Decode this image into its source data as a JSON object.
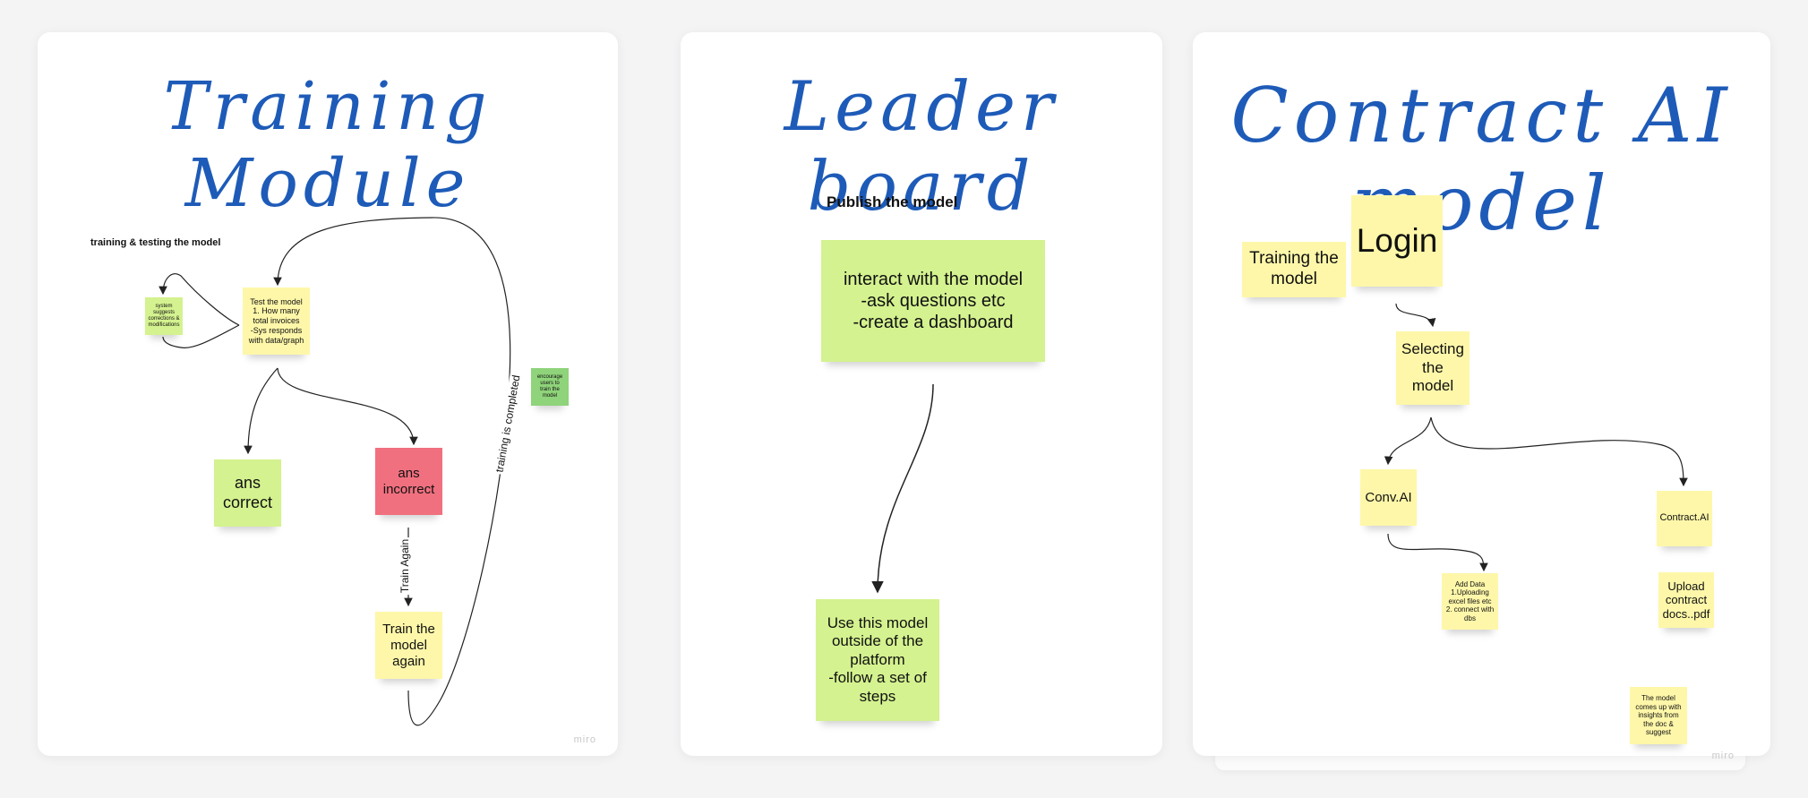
{
  "frames": {
    "training": {
      "title": "Training Module",
      "label": "training & testing the model",
      "watermark": "miro",
      "stickies": {
        "system": "system suggests corrections & modifications",
        "test": "Test the model\n1. How many total invoices\n-Sys responds with data/graph",
        "correct": "ans correct",
        "incorrect": "ans incorrect",
        "train_again": "Train the model again",
        "encourage": "encourage users to train the model"
      },
      "edges": {
        "train_again": "Train Again",
        "completed": "training is completed"
      }
    },
    "leaderboard": {
      "title": "Leader board",
      "label": "Publish the model",
      "stickies": {
        "interact": "interact with the model\n-ask questions etc\n-create a dashboard",
        "use": "Use this model outside of the platform\n-follow a set of steps"
      }
    },
    "contract": {
      "title": "Contract AI model",
      "watermark": "miro",
      "stickies": {
        "training": "Training the model",
        "login": "Login",
        "selecting": "Selecting the model",
        "conv": "Conv.AI",
        "contract": "Contract.AI",
        "add_data": "Add Data\n1.Uploading excel files etc\n2. connect with dbs",
        "upload": "Upload contract docs..pdf",
        "insights": "The model comes up with insights from the doc & suggest"
      }
    }
  },
  "colors": {
    "title": "#1e5bb8",
    "yellow": "#fef7a9",
    "light_green": "#d4f28f",
    "green": "#8fd37a",
    "pink": "#f1707f"
  }
}
